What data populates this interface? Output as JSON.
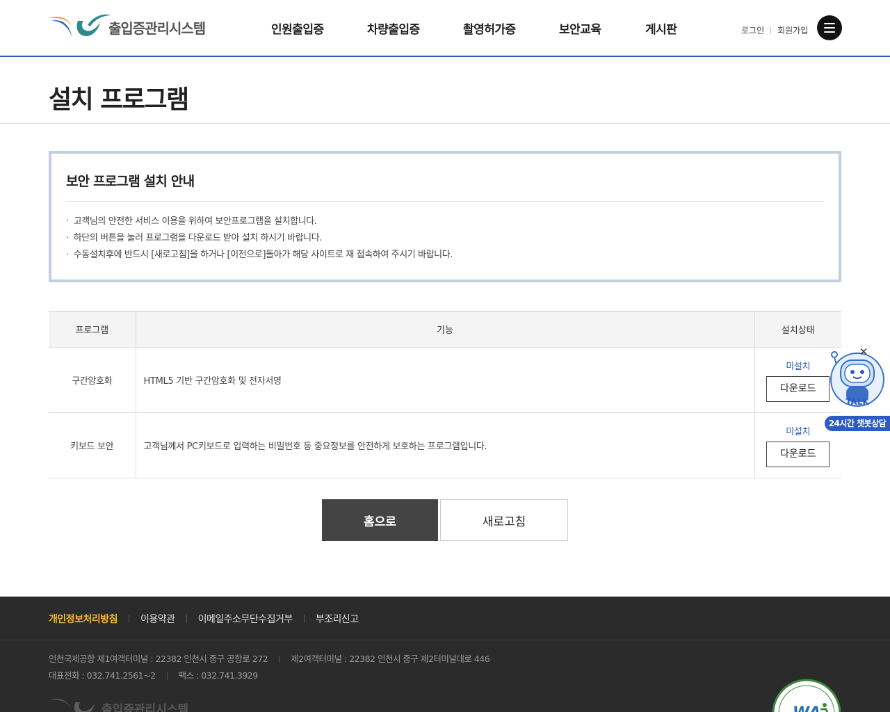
{
  "header": {
    "logo_text": "출입증관리시스템",
    "nav": [
      "인원출입증",
      "차량출입증",
      "촬영허가증",
      "보안교육",
      "게시판"
    ],
    "login": "로그인",
    "signup": "회원가입"
  },
  "page": {
    "title": "설치 프로그램"
  },
  "notice": {
    "title": "보안 프로그램 설치 안내",
    "items": [
      "고객님의 안전한 서비스 이용을 위하여 보안프로그램을 설치합니다.",
      "하단의 버튼을 눌러 프로그램을 다운로드 받아 설치 하시기 바랍니다.",
      "수동설치후에 반드시 [새로고침]을 하거나 [이전으로]돌아가 해당 사이트로 재 접속하여 주시기 바랍니다."
    ]
  },
  "table": {
    "headers": [
      "프로그램",
      "기능",
      "설치상태"
    ],
    "rows": [
      {
        "program": "구간암호화",
        "feature": "HTML5 기반 구간암호화 및 전자서명",
        "status": "미설치",
        "button": "다운로드"
      },
      {
        "program": "키보드 보안",
        "feature": "고객님께서 PC키보드로 입력하는 비밀번호 등 중요정보를 안전하게 보호하는 프로그램입니다.",
        "status": "미설치",
        "button": "다운로드"
      }
    ]
  },
  "buttons": {
    "home": "홈으로",
    "refresh": "새로고침"
  },
  "chatbot": {
    "talk": "TALK",
    "label": "24시간 챗봇상담",
    "close": "✕"
  },
  "footer": {
    "links": [
      "개인정보처리방침",
      "이용약관",
      "이메일주소무단수집거부",
      "부조리신고"
    ],
    "address1": "인천국제공항 제1여객터미널 : 22382 인천시 중구 공항로 272",
    "address2": "제2여객터미널 : 22382 인천시 중구 제2터미널대로 446",
    "phone": "대표전화 : 032.741.2561~2",
    "fax": "팩스 : 032.741.3929",
    "logo_text": "출입증관리시스템",
    "wa_text": "WA"
  },
  "colors": {
    "accent": "#3c59a8",
    "status_blue": "#2d5fb5",
    "footer_bg": "#2b2b2b",
    "footer_highlight": "#f2b632"
  }
}
